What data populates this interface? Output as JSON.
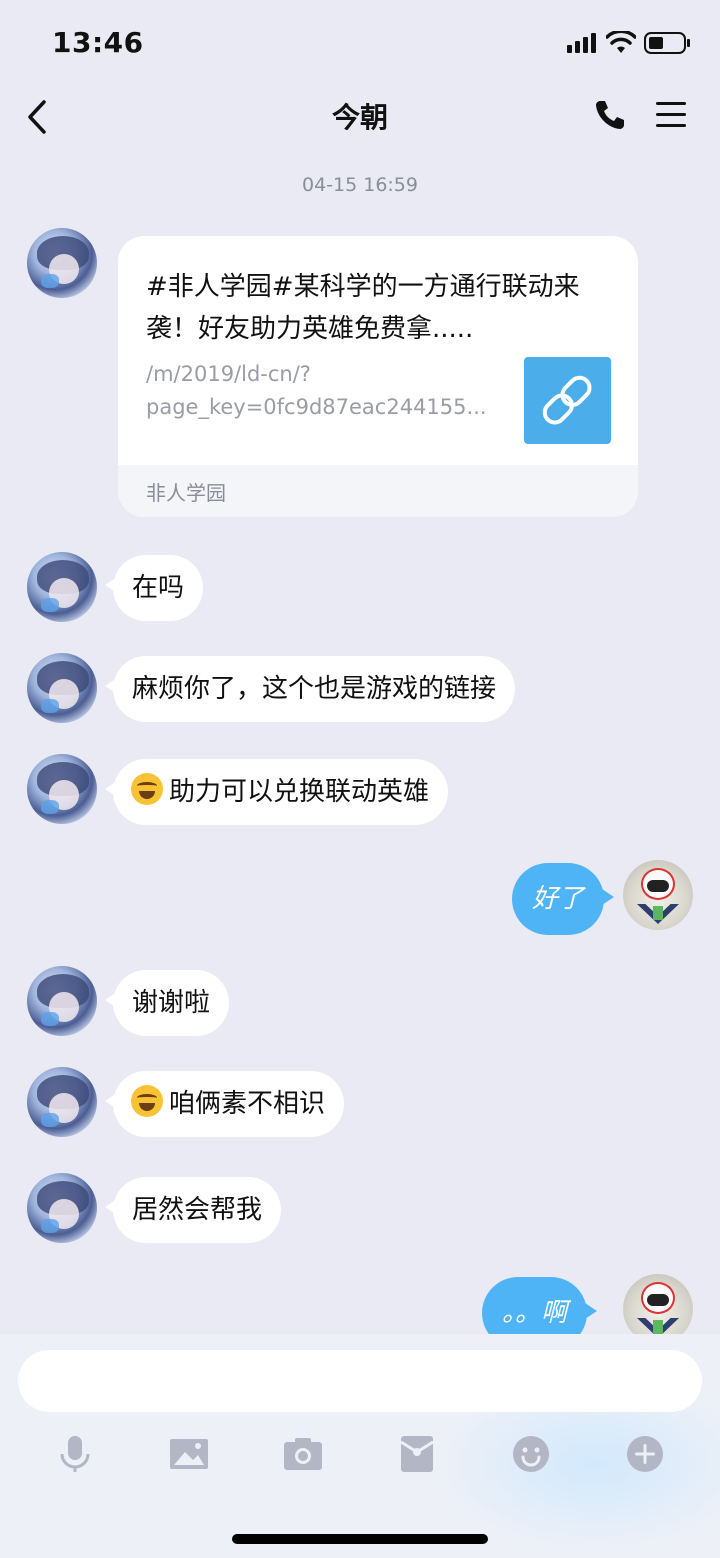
{
  "status_bar": {
    "time": "13:46"
  },
  "header": {
    "title": "今朝"
  },
  "conversation": {
    "timestamp": "04-15 16:59",
    "link_card": {
      "title": "#非人学园#某科学的一方通行联动来袭！好友助力英雄免费拿.....",
      "url_line1": "/m/2019/ld-cn/?",
      "url_line2": "page_key=0fc9d87eac244155...",
      "source": "非人学园"
    },
    "messages": [
      {
        "side": "left",
        "text": "在吗",
        "emoji": false
      },
      {
        "side": "left",
        "text": "麻烦你了，这个也是游戏的链接",
        "emoji": false
      },
      {
        "side": "left",
        "text": "助力可以兑换联动英雄",
        "emoji": true,
        "emoji_name": "tears-of-joy"
      },
      {
        "side": "right",
        "text": "好了"
      },
      {
        "side": "left",
        "text": "谢谢啦",
        "emoji": false
      },
      {
        "side": "left",
        "text": "咱俩素不相识",
        "emoji": true,
        "emoji_name": "tears-of-joy"
      },
      {
        "side": "left",
        "text": "居然会帮我",
        "emoji": false
      },
      {
        "side": "right",
        "text": "。。啊"
      }
    ]
  },
  "input": {
    "placeholder": ""
  },
  "toolbar": [
    "microphone-icon",
    "image-icon",
    "camera-icon",
    "red-packet-icon",
    "emoji-icon",
    "plus-icon"
  ],
  "colors": {
    "background": "#e9eaf3",
    "accent_blue": "#4fb4f5",
    "bubble": "#ffffff",
    "link_thumb": "#4baeea"
  }
}
